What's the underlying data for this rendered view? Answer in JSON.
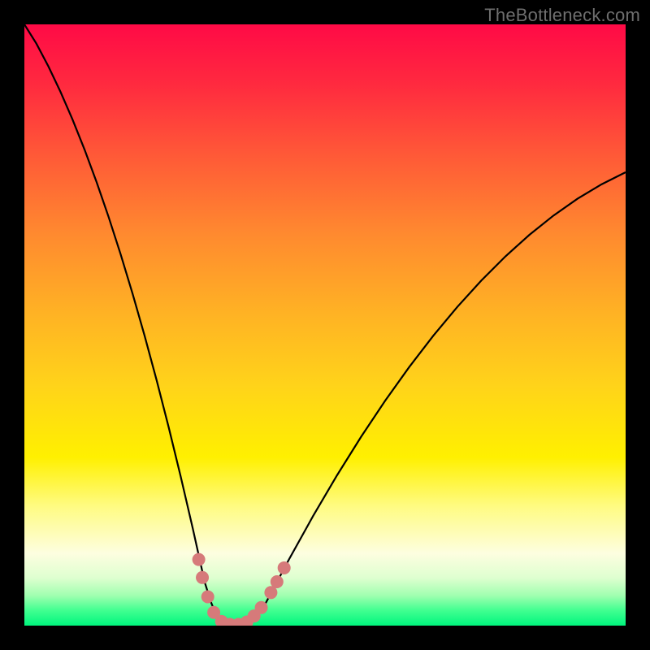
{
  "watermark": {
    "text": "TheBottleneck.com"
  },
  "colors": {
    "frame": "#000000",
    "curve_stroke": "#000000",
    "marker_fill": "#d67a7a",
    "gradient_top": "#ff0a46",
    "gradient_bottom": "#00f57d"
  },
  "chart_data": {
    "type": "line",
    "title": "",
    "xlabel": "",
    "ylabel": "",
    "xlim": [
      0,
      100
    ],
    "ylim": [
      0,
      100
    ],
    "grid": false,
    "legend": false,
    "x": [
      0,
      2,
      4,
      6,
      8,
      10,
      12,
      14,
      16,
      18,
      20,
      22,
      24,
      26,
      28,
      30,
      31,
      32,
      33,
      34,
      35,
      36,
      37,
      38,
      40,
      44,
      48,
      52,
      56,
      60,
      64,
      68,
      72,
      76,
      80,
      84,
      88,
      92,
      96,
      100
    ],
    "y": [
      100,
      96.8,
      93.0,
      88.8,
      84.2,
      79.2,
      73.8,
      68.0,
      61.8,
      55.2,
      48.2,
      40.8,
      33.0,
      24.8,
      16.2,
      7.2,
      4.0,
      1.5,
      0.3,
      0.0,
      0.0,
      0.0,
      0.3,
      1.0,
      3.5,
      11.0,
      18.2,
      25.0,
      31.4,
      37.4,
      43.0,
      48.2,
      53.0,
      57.4,
      61.4,
      65.0,
      68.2,
      71.0,
      73.4,
      75.4
    ],
    "series": [
      {
        "name": "bottleneck-curve",
        "x_ref": "x",
        "y_ref": "y"
      }
    ],
    "markers": {
      "name": "highlight-points",
      "points": [
        {
          "x": 29.0,
          "y": 11.0
        },
        {
          "x": 29.6,
          "y": 8.0
        },
        {
          "x": 30.5,
          "y": 4.8
        },
        {
          "x": 31.5,
          "y": 2.2
        },
        {
          "x": 32.8,
          "y": 0.7
        },
        {
          "x": 34.2,
          "y": 0.2
        },
        {
          "x": 35.6,
          "y": 0.2
        },
        {
          "x": 37.0,
          "y": 0.6
        },
        {
          "x": 38.2,
          "y": 1.6
        },
        {
          "x": 39.4,
          "y": 3.0
        },
        {
          "x": 41.0,
          "y": 5.5
        },
        {
          "x": 42.0,
          "y": 7.3
        },
        {
          "x": 43.2,
          "y": 9.6
        }
      ]
    }
  }
}
